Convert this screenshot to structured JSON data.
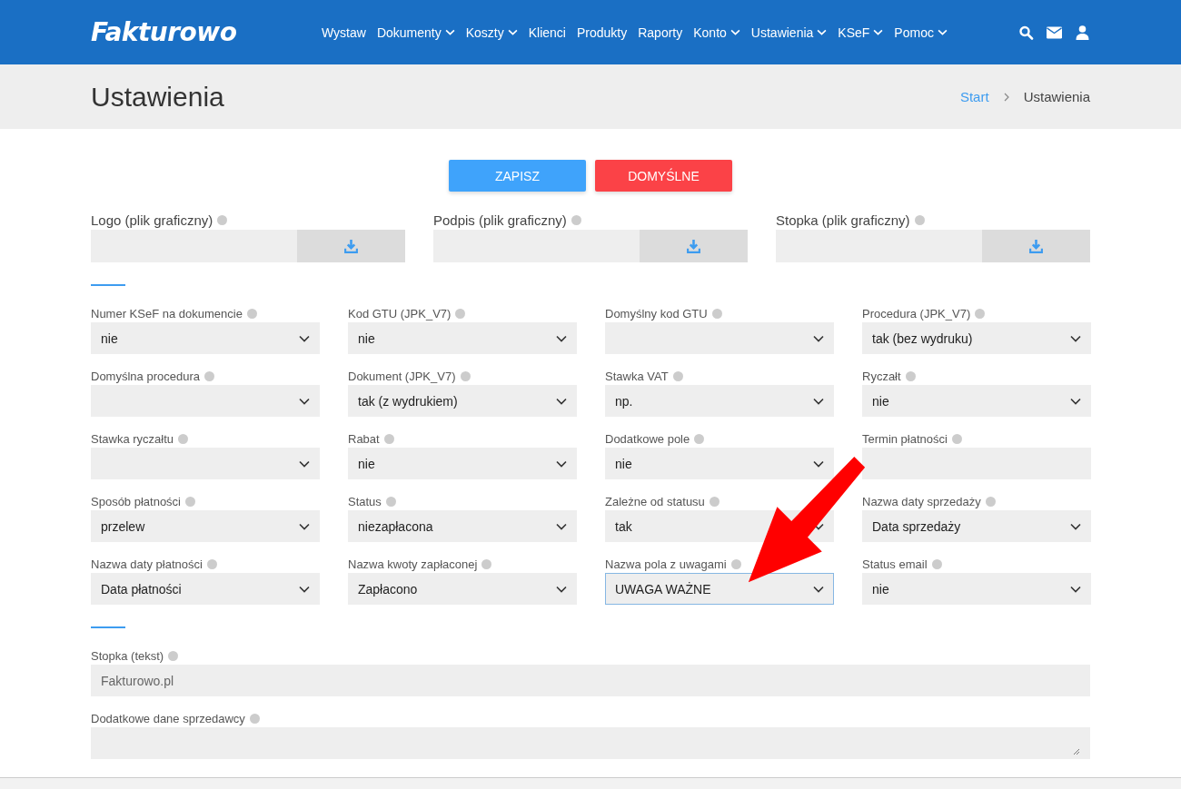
{
  "brand": "Fakturowo",
  "nav": [
    {
      "label": "Wystaw",
      "dropdown": false
    },
    {
      "label": "Dokumenty",
      "dropdown": true
    },
    {
      "label": "Koszty",
      "dropdown": true
    },
    {
      "label": "Klienci",
      "dropdown": false
    },
    {
      "label": "Produkty",
      "dropdown": false
    },
    {
      "label": "Raporty",
      "dropdown": false
    },
    {
      "label": "Konto",
      "dropdown": true
    },
    {
      "label": "Ustawienia",
      "dropdown": true
    },
    {
      "label": "KSeF",
      "dropdown": true
    },
    {
      "label": "Pomoc",
      "dropdown": true
    }
  ],
  "page_title": "Ustawienia",
  "breadcrumb": [
    "Start",
    "Ustawienia"
  ],
  "buttons": [
    {
      "label": "ZAPISZ",
      "kind": "primary"
    },
    {
      "label": "DOMYŚLNE",
      "kind": "danger"
    }
  ],
  "uploads": [
    "Logo (plik graficzny)",
    "Podpis (plik graficzny)",
    "Stopka (plik graficzny)"
  ],
  "fields": [
    {
      "label": "Numer KSeF na dokumencie",
      "kind": "select",
      "value": "nie",
      "focused": false
    },
    {
      "label": "Kod GTU (JPK_V7)",
      "kind": "select",
      "value": "nie",
      "focused": false
    },
    {
      "label": "Domyślny kod GTU",
      "kind": "select",
      "focused": false
    },
    {
      "label": "Procedura (JPK_V7)",
      "kind": "select",
      "value": "tak (bez wydruku)",
      "focused": false
    },
    {
      "label": "Domyślna procedura",
      "kind": "select",
      "focused": false
    },
    {
      "label": "Dokument (JPK_V7)",
      "kind": "select",
      "value": "tak (z wydrukiem)",
      "focused": false
    },
    {
      "label": "Stawka VAT",
      "kind": "select",
      "value": "np.",
      "focused": false
    },
    {
      "label": "Ryczałt",
      "kind": "select",
      "value": "nie",
      "focused": false
    },
    {
      "label": "Stawka ryczałtu",
      "kind": "select",
      "focused": false
    },
    {
      "label": "Rabat",
      "kind": "select",
      "value": "nie",
      "focused": false
    },
    {
      "label": "Dodatkowe pole",
      "kind": "select",
      "value": "nie",
      "focused": false
    },
    {
      "label": "Termin płatności",
      "kind": "input",
      "focused": false
    },
    {
      "label": "Sposób płatności",
      "kind": "select",
      "value": "przelew",
      "focused": false
    },
    {
      "label": "Status",
      "kind": "select",
      "value": "niezapłacona",
      "focused": false
    },
    {
      "label": "Zależne od statusu",
      "kind": "select",
      "value": "tak",
      "focused": false
    },
    {
      "label": "Nazwa daty sprzedaży",
      "kind": "select",
      "value": "Data sprzedaży",
      "focused": false
    },
    {
      "label": "Nazwa daty płatności",
      "kind": "select",
      "value": "Data płatności",
      "focused": false
    },
    {
      "label": "Nazwa kwoty zapłaconej",
      "kind": "select",
      "value": "Zapłacono",
      "focused": false
    },
    {
      "label": "Nazwa pola z uwagami",
      "kind": "select",
      "value": "UWAGA WAŻNE",
      "focused": true
    },
    {
      "label": "Status email",
      "kind": "select",
      "value": "nie",
      "focused": false
    }
  ],
  "text_fields": [
    {
      "label": "Stopka (tekst)",
      "kind": "input",
      "value": "Fakturowo.pl"
    },
    {
      "label": "Dodatkowe dane sprzedawcy",
      "kind": "textarea"
    }
  ]
}
